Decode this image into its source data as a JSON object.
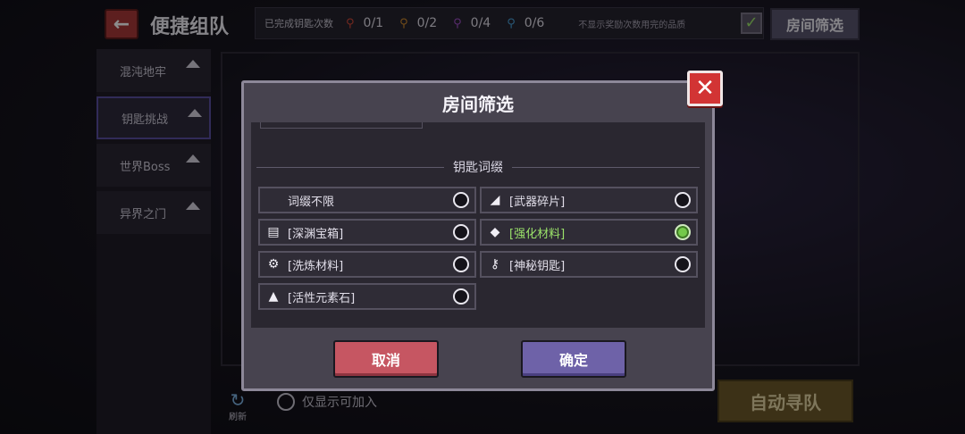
{
  "header": {
    "back_icon": "arrow-left-icon",
    "title": "便捷组队",
    "stats_label": "已完成钥匙次数",
    "keys": [
      {
        "icon": "red-key-icon",
        "color": "#d24a3a",
        "value": "0/1"
      },
      {
        "icon": "orange-key-icon",
        "color": "#d08a2e",
        "value": "0/2"
      },
      {
        "icon": "purple-key-icon",
        "color": "#a050c8",
        "value": "0/4"
      },
      {
        "icon": "blue-key-icon",
        "color": "#4aa0d8",
        "value": "0/6"
      }
    ],
    "hide_label": "不显示奖励次数用完的品质",
    "filter_button": "房间筛选"
  },
  "sidebar": {
    "items": [
      {
        "label": "混沌地牢"
      },
      {
        "label": "钥匙挑战"
      },
      {
        "label": "世界Boss"
      },
      {
        "label": "异界之门"
      }
    ]
  },
  "footer": {
    "refresh_label": "刷新",
    "only_joinable": "仅显示可加入",
    "auto_match": "自动寻队"
  },
  "modal": {
    "title": "房间筛选",
    "section_title": "钥匙词缀",
    "options": [
      {
        "label": "词缀不限",
        "icon": "",
        "selected": false
      },
      {
        "label": "[武器碎片]",
        "icon": "weapon-shard-icon",
        "selected": false
      },
      {
        "label": "[深渊宝箱]",
        "icon": "chest-icon",
        "selected": false
      },
      {
        "label": "[强化材料]",
        "icon": "gem-icon",
        "selected": true
      },
      {
        "label": "[洗炼材料]",
        "icon": "gear-icon",
        "selected": false
      },
      {
        "label": "[神秘钥匙]",
        "icon": "key-icon",
        "selected": false
      },
      {
        "label": "[活性元素石]",
        "icon": "crystal-icon",
        "selected": false
      }
    ],
    "cancel": "取消",
    "confirm": "确定"
  }
}
